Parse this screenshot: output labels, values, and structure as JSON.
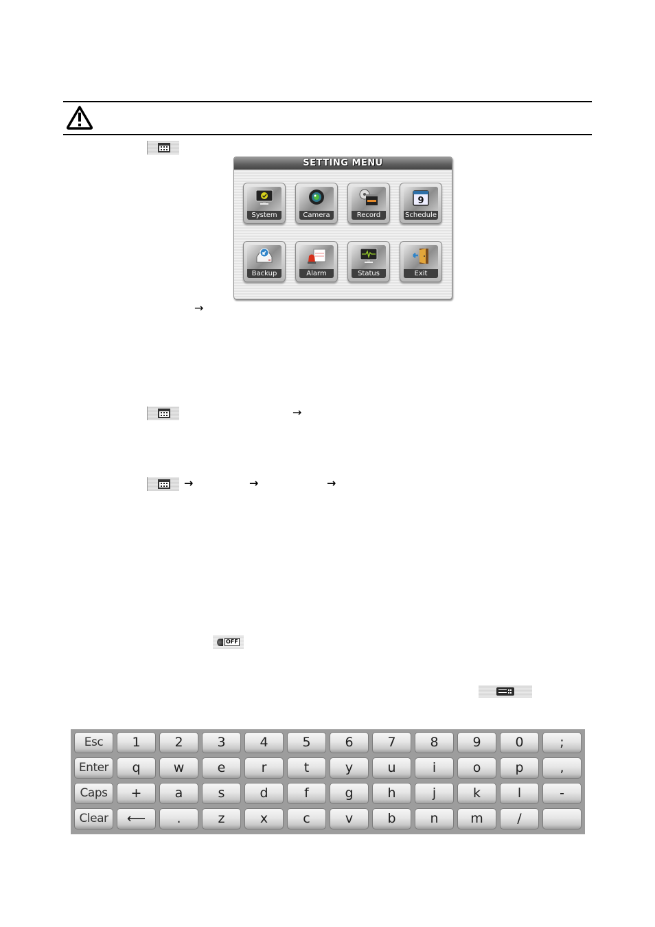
{
  "warning": {
    "icon": "warning-triangle-icon"
  },
  "menu_key_icon": "menu-key-icon",
  "setting_menu": {
    "title": "SETTING MENU",
    "items": [
      {
        "label": "System",
        "icon": "monitor-check-icon"
      },
      {
        "label": "Camera",
        "icon": "camera-lens-icon"
      },
      {
        "label": "Record",
        "icon": "film-reel-icon"
      },
      {
        "label": "Schedule",
        "icon": "calendar-icon"
      },
      {
        "label": "Backup",
        "icon": "backup-drive-icon"
      },
      {
        "label": "Alarm",
        "icon": "alarm-siren-icon"
      },
      {
        "label": "Status",
        "icon": "status-monitor-icon"
      },
      {
        "label": "Exit",
        "icon": "exit-door-icon"
      }
    ]
  },
  "arrows": {
    "symbol": "→"
  },
  "off_icon": {
    "text": "OFF"
  },
  "keyboard_icon": "keyboard-icon",
  "virtual_keyboard": {
    "rows": [
      [
        "Esc",
        "1",
        "2",
        "3",
        "4",
        "5",
        "6",
        "7",
        "8",
        "9",
        "0",
        ";"
      ],
      [
        "Enter",
        "q",
        "w",
        "e",
        "r",
        "t",
        "y",
        "u",
        "i",
        "o",
        "p",
        ","
      ],
      [
        "Caps",
        "+",
        "a",
        "s",
        "d",
        "f",
        "g",
        "h",
        "j",
        "k",
        "l",
        "-"
      ],
      [
        "Clear",
        "⟵",
        ".",
        "z",
        "x",
        "c",
        "v",
        "b",
        "n",
        "m",
        "/",
        ""
      ]
    ]
  }
}
